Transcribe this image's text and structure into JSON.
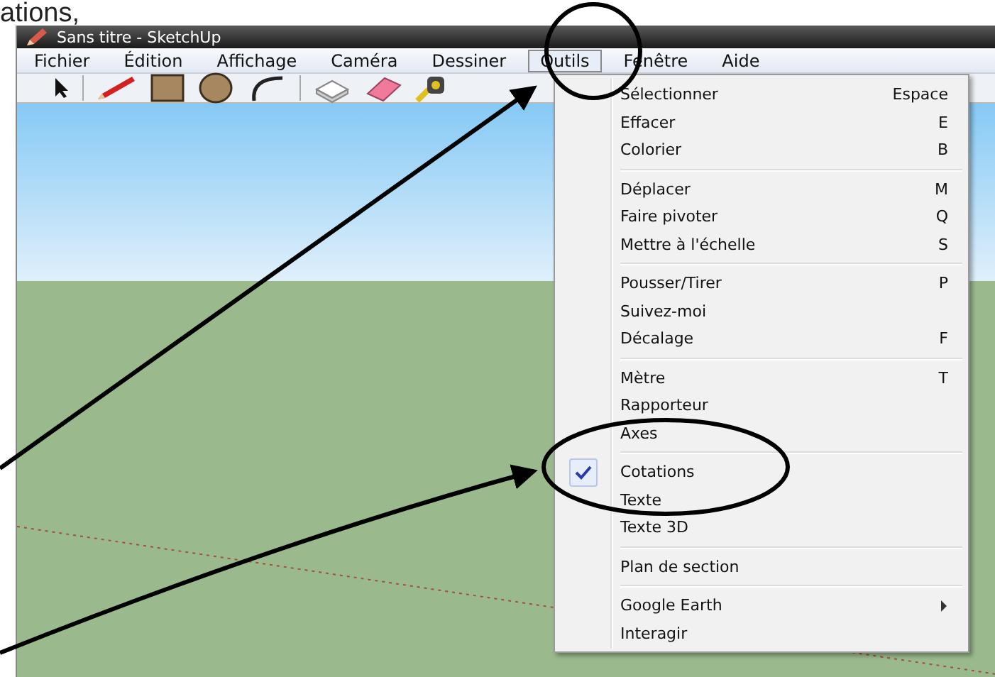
{
  "caption": "ations,",
  "window": {
    "title": "Sans titre - SketchUp"
  },
  "menu_bar": [
    {
      "label": "Fichier",
      "selected": false
    },
    {
      "label": "Édition",
      "selected": false
    },
    {
      "label": "Affichage",
      "selected": false
    },
    {
      "label": "Caméra",
      "selected": false
    },
    {
      "label": "Dessiner",
      "selected": false
    },
    {
      "label": "Outils",
      "selected": true
    },
    {
      "label": "Fenêtre",
      "selected": false
    },
    {
      "label": "Aide",
      "selected": false
    }
  ],
  "tools_menu": {
    "groups": [
      [
        {
          "label": "Sélectionner",
          "shortcut": "Espace",
          "checked": false,
          "submenu": false
        },
        {
          "label": "Effacer",
          "shortcut": "E",
          "checked": false,
          "submenu": false
        },
        {
          "label": "Colorier",
          "shortcut": "B",
          "checked": false,
          "submenu": false
        }
      ],
      [
        {
          "label": "Déplacer",
          "shortcut": "M",
          "checked": false,
          "submenu": false
        },
        {
          "label": "Faire pivoter",
          "shortcut": "Q",
          "checked": false,
          "submenu": false
        },
        {
          "label": "Mettre à l'échelle",
          "shortcut": "S",
          "checked": false,
          "submenu": false
        }
      ],
      [
        {
          "label": "Pousser/Tirer",
          "shortcut": "P",
          "checked": false,
          "submenu": false
        },
        {
          "label": "Suivez-moi",
          "checked": false,
          "submenu": false
        },
        {
          "label": "Décalage",
          "shortcut": "F",
          "checked": false,
          "submenu": false
        }
      ],
      [
        {
          "label": "Mètre",
          "shortcut": "T",
          "checked": false,
          "submenu": false
        },
        {
          "label": "Rapporteur",
          "checked": false,
          "submenu": false
        },
        {
          "label": "Axes",
          "checked": false,
          "submenu": false
        }
      ],
      [
        {
          "label": "Cotations",
          "checked": true,
          "submenu": false
        },
        {
          "label": "Texte",
          "checked": false,
          "submenu": false
        },
        {
          "label": "Texte 3D",
          "checked": false,
          "submenu": false
        }
      ],
      [
        {
          "label": "Plan de section",
          "checked": false,
          "submenu": false
        }
      ],
      [
        {
          "label": "Google Earth",
          "checked": false,
          "submenu": true
        },
        {
          "label": "Interagir",
          "checked": false,
          "submenu": false
        }
      ]
    ]
  }
}
